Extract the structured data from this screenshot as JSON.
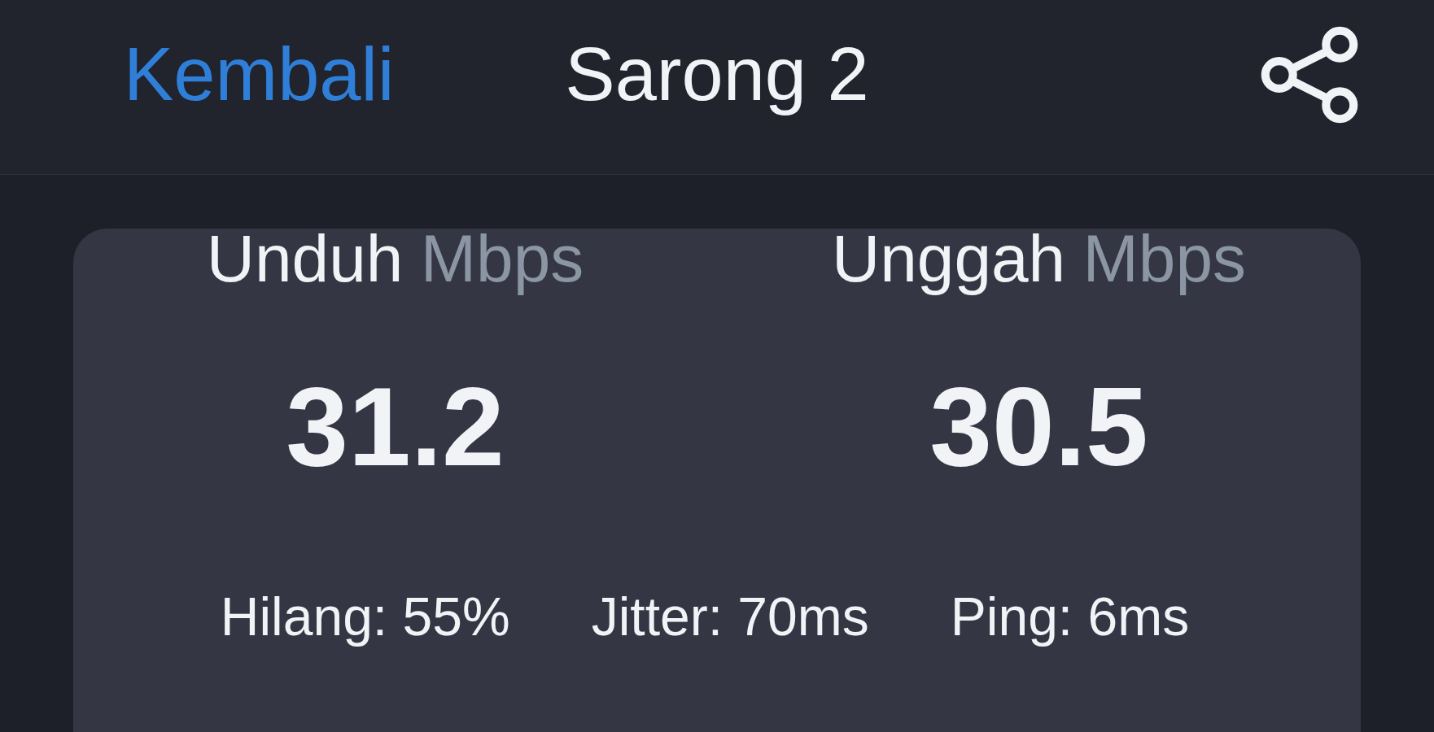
{
  "header": {
    "back_link": "Kembali",
    "title": "Sarong 2"
  },
  "result_card": {
    "metrics": [
      {
        "label": "Unduh",
        "unit": "Mbps",
        "value": "31.2"
      },
      {
        "label": "Unggah",
        "unit": "Mbps",
        "value": "30.5"
      }
    ],
    "stats": [
      "Hilang: 55%",
      "Jitter: 70ms",
      "Ping: 6ms"
    ]
  }
}
